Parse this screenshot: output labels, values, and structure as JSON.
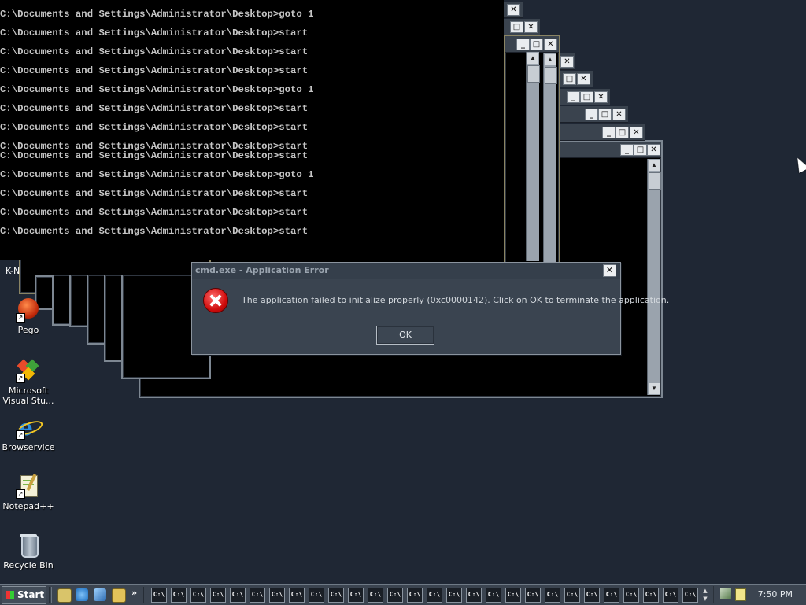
{
  "console": {
    "lines": [
      "C:\\Documents and Settings\\Administrator\\Desktop>goto 1",
      "C:\\Documents and Settings\\Administrator\\Desktop>start",
      "C:\\Documents and Settings\\Administrator\\Desktop>start",
      "C:\\Documents and Settings\\Administrator\\Desktop>start",
      "C:\\Documents and Settings\\Administrator\\Desktop>goto 1",
      "C:\\Documents and Settings\\Administrator\\Desktop>start",
      "C:\\Documents and Settings\\Administrator\\Desktop>start",
      "C:\\Documents and Settings\\Administrator\\Desktop>start",
      "C:\\Documents and Settings\\Administrator\\Desktop>start",
      "C:\\Documents and Settings\\Administrator\\Desktop>goto 1",
      "C:\\Documents and Settings\\Administrator\\Desktop>start",
      "C:\\Documents and Settings\\Administrator\\Desktop>start",
      "C:\\Documents and Settings\\Administrator\\Desktop>start"
    ]
  },
  "window_controls": {
    "minimize": "_",
    "maximize": "□",
    "close": "✕"
  },
  "dialog": {
    "title": "cmd.exe - Application Error",
    "message": "The application failed to initialize properly (0xc0000142). Click on OK to terminate the application.",
    "ok_label": "OK",
    "close_label": "✕",
    "icon": "error-icon"
  },
  "desktop": {
    "partial_label": "K-N",
    "icons": [
      {
        "label": "Pego",
        "icon": "pego-icon"
      },
      {
        "label": "Microsoft Visual Stu...",
        "icon": "visual-studio-icon"
      },
      {
        "label": "Browservice",
        "icon": "internet-explorer-icon"
      },
      {
        "label": "Notepad++",
        "icon": "notepadpp-icon"
      },
      {
        "label": "Recycle Bin",
        "icon": "recycle-bin-icon"
      }
    ]
  },
  "taskbar": {
    "start_label": "Start",
    "overflow_label": "»",
    "task_button_label": "C:\\",
    "task_button_count": 28,
    "clock": "7:50 PM"
  }
}
